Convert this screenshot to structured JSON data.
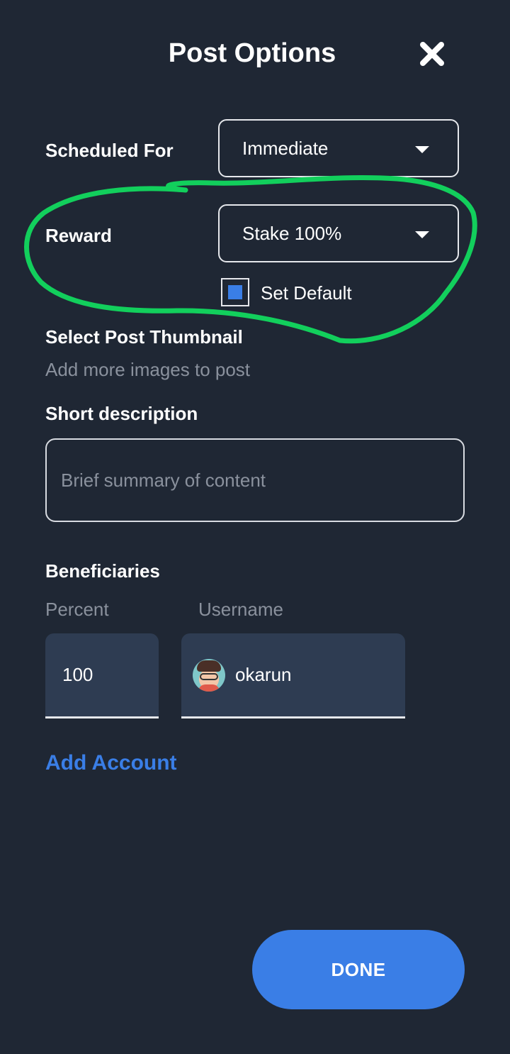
{
  "header": {
    "title": "Post Options"
  },
  "scheduled": {
    "label": "Scheduled For",
    "value": "Immediate"
  },
  "reward": {
    "label": "Reward",
    "value": "Stake 100%",
    "set_default_label": "Set Default",
    "set_default_checked": true
  },
  "thumbnail": {
    "label": "Select Post Thumbnail",
    "hint": "Add more images to post"
  },
  "description": {
    "label": "Short description",
    "placeholder": "Brief summary of content"
  },
  "beneficiaries": {
    "label": "Beneficiaries",
    "percent_header": "Percent",
    "username_header": "Username",
    "rows": [
      {
        "percent": "100",
        "username": "okarun"
      }
    ],
    "add_account_label": "Add Account"
  },
  "footer": {
    "done_label": "DONE"
  },
  "colors": {
    "background": "#1f2734",
    "accent": "#3a7ee6",
    "field_bg": "#2e3c52",
    "annotation": "#12cf5c"
  },
  "icons": {
    "close": "close-icon",
    "dropdown": "caret-down-icon",
    "avatar": "user-avatar"
  }
}
